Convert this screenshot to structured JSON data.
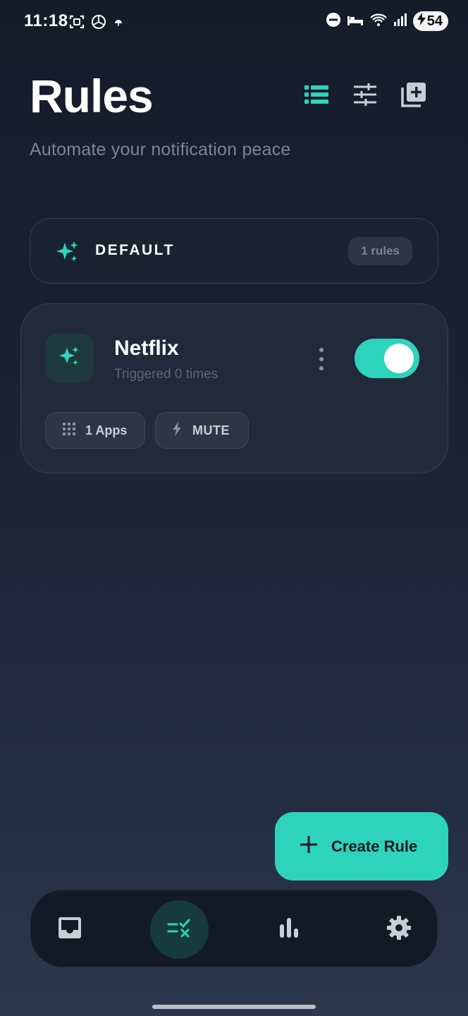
{
  "status_bar": {
    "time": "11:18",
    "battery": "54",
    "icons": [
      "screenshot-icon",
      "openai-icon",
      "weather-icon",
      "dnd-icon",
      "sleep-icon",
      "wifi-icon",
      "signal-icon",
      "battery-icon"
    ]
  },
  "header": {
    "title": "Rules",
    "subtitle": "Automate your notification peace",
    "actions": [
      "list-view-icon",
      "filter-sliders-icon",
      "add-box-icon"
    ]
  },
  "group": {
    "label": "DEFAULT",
    "count": "1 rules",
    "icon": "sparkle-icon"
  },
  "rules": [
    {
      "name": "Netflix",
      "subtitle": "Triggered 0 times",
      "enabled": true,
      "apps_chip": "1 Apps",
      "action_chip": "MUTE"
    }
  ],
  "fab": {
    "label": "Create Rule"
  },
  "bottom_nav": {
    "items": [
      "inbox-icon",
      "rules-icon",
      "stats-icon",
      "settings-icon"
    ],
    "active": "rules-icon"
  },
  "colors": {
    "accent": "#2ed3bb",
    "background_top": "#151b29",
    "background_bottom": "#2c384c"
  }
}
